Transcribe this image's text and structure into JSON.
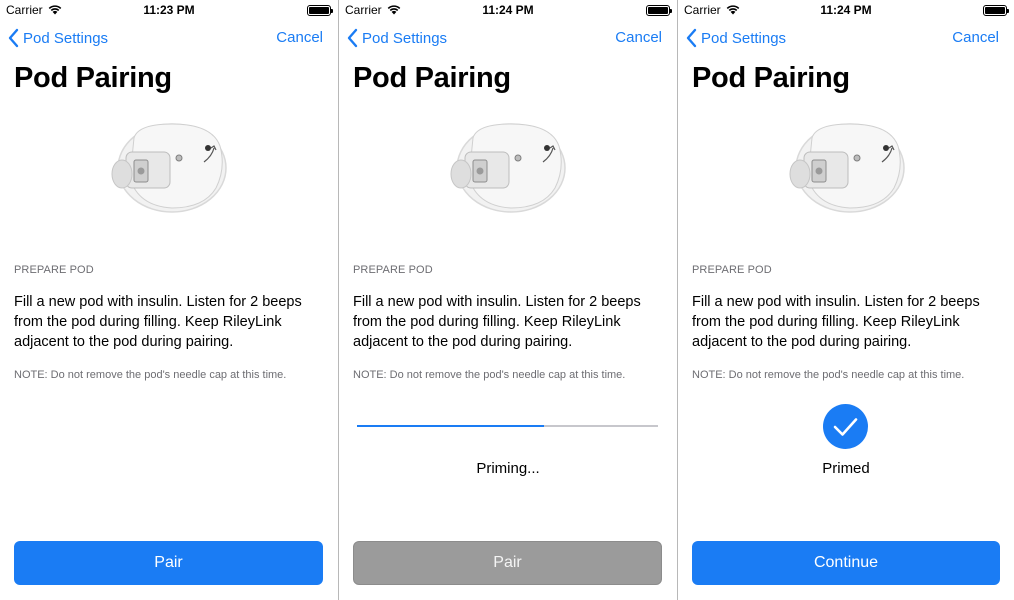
{
  "colors": {
    "accent": "#1a7cf4",
    "disabled_button": "#9b9b9b",
    "secondary_text": "#6d6d72"
  },
  "screens": [
    {
      "status_bar": {
        "carrier": "Carrier",
        "time": "11:23 PM"
      },
      "nav": {
        "back_label": "Pod Settings",
        "cancel_label": "Cancel"
      },
      "title": "Pod Pairing",
      "section_header": "PREPARE POD",
      "instructions": "Fill a new pod with insulin. Listen for 2 beeps from the pod during filling. Keep RileyLink adjacent to the pod during pairing.",
      "note": "NOTE: Do not remove the pod's needle cap at this time.",
      "button": {
        "label": "Pair",
        "enabled": true
      }
    },
    {
      "status_bar": {
        "carrier": "Carrier",
        "time": "11:24 PM"
      },
      "nav": {
        "back_label": "Pod Settings",
        "cancel_label": "Cancel"
      },
      "title": "Pod Pairing",
      "section_header": "PREPARE POD",
      "instructions": "Fill a new pod with insulin. Listen for 2 beeps from the pod during filling. Keep RileyLink adjacent to the pod during pairing.",
      "note": "NOTE: Do not remove the pod's needle cap at this time.",
      "progress": {
        "fraction": 0.62,
        "status": "Priming..."
      },
      "button": {
        "label": "Pair",
        "enabled": false
      }
    },
    {
      "status_bar": {
        "carrier": "Carrier",
        "time": "11:24 PM"
      },
      "nav": {
        "back_label": "Pod Settings",
        "cancel_label": "Cancel"
      },
      "title": "Pod Pairing",
      "section_header": "PREPARE POD",
      "instructions": "Fill a new pod with insulin. Listen for 2 beeps from the pod during filling. Keep RileyLink adjacent to the pod during pairing.",
      "note": "NOTE: Do not remove the pod's needle cap at this time.",
      "result": {
        "icon": "checkmark-circle-icon",
        "label": "Primed"
      },
      "button": {
        "label": "Continue",
        "enabled": true
      }
    }
  ]
}
